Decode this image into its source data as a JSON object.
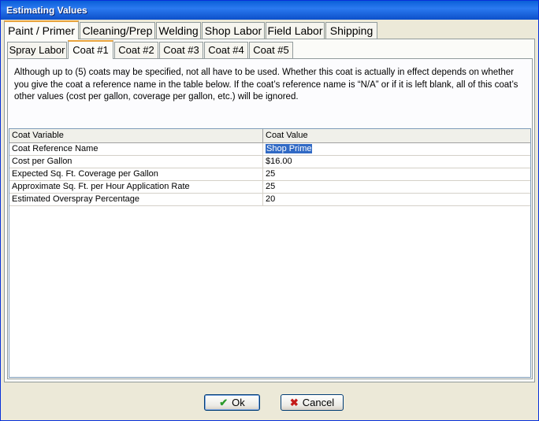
{
  "window": {
    "title": "Estimating Values"
  },
  "main_tabs": [
    {
      "label": "Paint / Primer",
      "active": true
    },
    {
      "label": "Cleaning/Prep",
      "active": false
    },
    {
      "label": "Welding",
      "active": false
    },
    {
      "label": "Shop Labor",
      "active": false
    },
    {
      "label": "Field Labor",
      "active": false
    },
    {
      "label": "Shipping",
      "active": false
    }
  ],
  "sub_tabs": [
    {
      "label": "Spray Labor",
      "active": false
    },
    {
      "label": "Coat #1",
      "active": true
    },
    {
      "label": "Coat #2",
      "active": false
    },
    {
      "label": "Coat #3",
      "active": false
    },
    {
      "label": "Coat #4",
      "active": false
    },
    {
      "label": "Coat #5",
      "active": false
    }
  ],
  "description": "Although up to (5) coats may be specified, not all have to be used.  Whether this coat is actually in effect depends on whether you give the coat a reference name in the table below.  If the coat’s reference name is “N/A” or if it is left blank, all of this coat’s other values (cost per gallon, coverage per gallon, etc.) will be ignored.",
  "grid": {
    "headers": [
      "Coat Variable",
      "Coat Value"
    ],
    "rows": [
      {
        "variable": "Coat Reference Name",
        "value": "Shop Prime"
      },
      {
        "variable": "Cost per Gallon",
        "value": "$16.00"
      },
      {
        "variable": "Expected Sq. Ft. Coverage per Gallon",
        "value": "25"
      },
      {
        "variable": "Approximate Sq. Ft. per Hour Application Rate",
        "value": "25"
      },
      {
        "variable": "Estimated Overspray Percentage",
        "value": "20"
      }
    ]
  },
  "buttons": {
    "ok_label": "Ok",
    "cancel_label": "Cancel"
  },
  "icons": {
    "ok": "checkmark-icon",
    "cancel": "x-icon"
  },
  "colors": {
    "titlebar": "#0a5fd8",
    "active_tab_accent": "#e8a33d",
    "selection": "#316ac5"
  }
}
